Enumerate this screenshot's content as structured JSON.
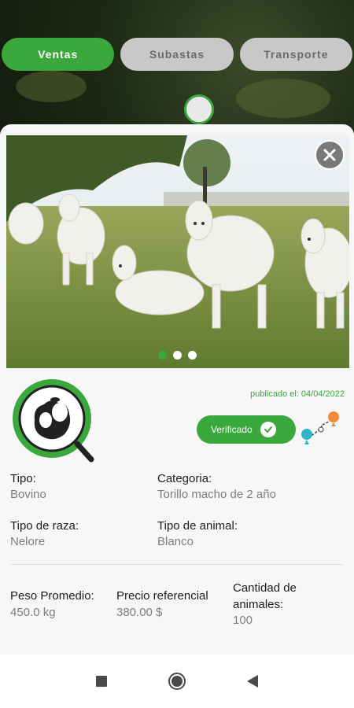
{
  "tabs": [
    {
      "label": "Ventas",
      "active": true
    },
    {
      "label": "Subastas",
      "active": false
    },
    {
      "label": "Transporte",
      "active": false
    }
  ],
  "carousel": {
    "count": 3,
    "active_index": 0
  },
  "published": "publicado el: 04/04/2022",
  "verified_label": "Verificado",
  "details": {
    "tipo": {
      "label": "Tipo:",
      "value": "Bovino"
    },
    "categoria": {
      "label": "Categoria:",
      "value": "Torillo macho de 2 año"
    },
    "tipo_raza": {
      "label": "Tipo de raza:",
      "value": "Nelore"
    },
    "tipo_animal": {
      "label": "Tipo de animal:",
      "value": "Blanco"
    },
    "peso": {
      "label": "Peso Promedio:",
      "value": "450.0 kg"
    },
    "precio": {
      "label": "Precio referencial",
      "value": "380.00 $"
    },
    "cantidad": {
      "label_line1": "Cantidad de",
      "label_line2": "animales:",
      "value": "100"
    }
  },
  "icons": {
    "close": "close-icon",
    "check": "check-circle-icon",
    "route": "route-pins-icon",
    "nav_recent": "square-icon",
    "nav_home": "circle-icon",
    "nav_back": "triangle-back-icon"
  },
  "colors": {
    "accent": "#3aa83c",
    "inactive_tab": "#c8c8c8"
  }
}
